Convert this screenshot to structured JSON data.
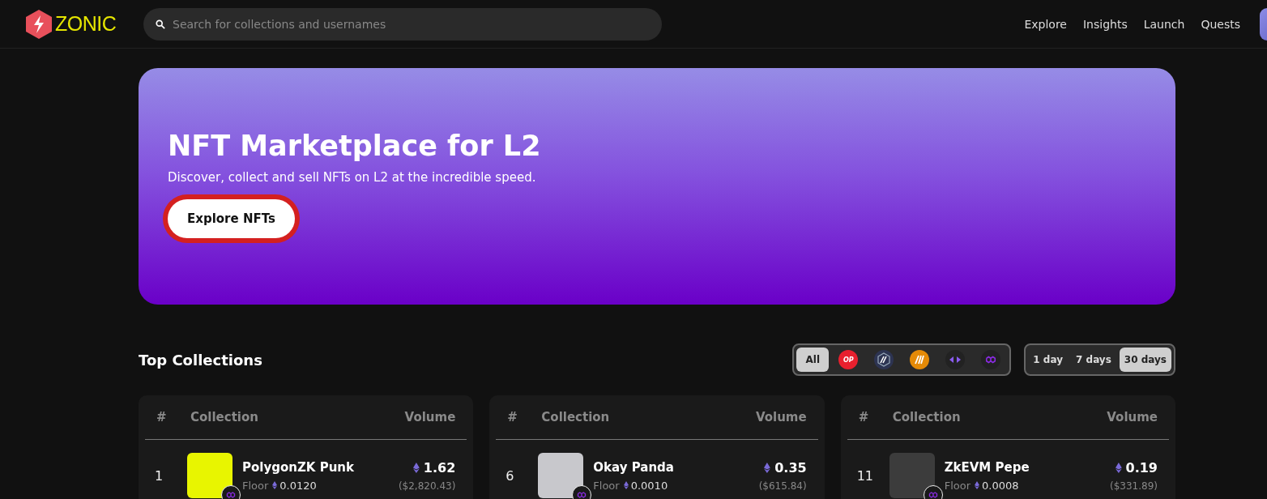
{
  "header": {
    "logo": "ZONIC",
    "search": {
      "placeholder": "Search for collections and usernames"
    },
    "nav": [
      {
        "label": "Explore"
      },
      {
        "label": "Insights"
      },
      {
        "label": "Launch"
      },
      {
        "label": "Quests"
      }
    ]
  },
  "hero": {
    "title": "NFT Marketplace for L2",
    "subtitle": "Discover, collect and sell NFTs on L2 at the incredible speed.",
    "button": {
      "label": "Explore NFTs",
      "highlighted": true
    }
  },
  "top_collections": {
    "title": "Top Collections",
    "chains": [
      {
        "kind": "all",
        "label": "All",
        "selected": true
      },
      {
        "kind": "op",
        "label": "OP",
        "selected": false
      },
      {
        "kind": "arbitrum",
        "selected": false
      },
      {
        "kind": "nova",
        "selected": false
      },
      {
        "kind": "bridge",
        "selected": false
      },
      {
        "kind": "polygon",
        "selected": false
      }
    ],
    "periods": [
      {
        "label": "1 day",
        "selected": false
      },
      {
        "label": "7 days",
        "selected": false
      },
      {
        "label": "30 days",
        "selected": true
      }
    ],
    "tables": [
      {
        "columns": [
          "#",
          "Collection",
          "Volume"
        ],
        "rows": [
          {
            "rank": "1",
            "name": "PolygonZK Punk",
            "floor_label": "Floor",
            "floor": "0.0120",
            "volume": "1.62",
            "usd": "($2,820.43)",
            "color": "#e8f500"
          }
        ]
      },
      {
        "columns": [
          "#",
          "Collection",
          "Volume"
        ],
        "rows": [
          {
            "rank": "6",
            "name": "Okay Panda",
            "floor_label": "Floor",
            "floor": "0.0010",
            "volume": "0.35",
            "usd": "($615.84)",
            "color": "#c8c8cc"
          }
        ]
      },
      {
        "columns": [
          "#",
          "Collection",
          "Volume"
        ],
        "rows": [
          {
            "rank": "11",
            "name": "ZkEVM Pepe",
            "floor_label": "Floor",
            "floor": "0.0008",
            "volume": "0.19",
            "usd": "($331.89)",
            "color": "#3c3c3c"
          }
        ]
      }
    ]
  }
}
